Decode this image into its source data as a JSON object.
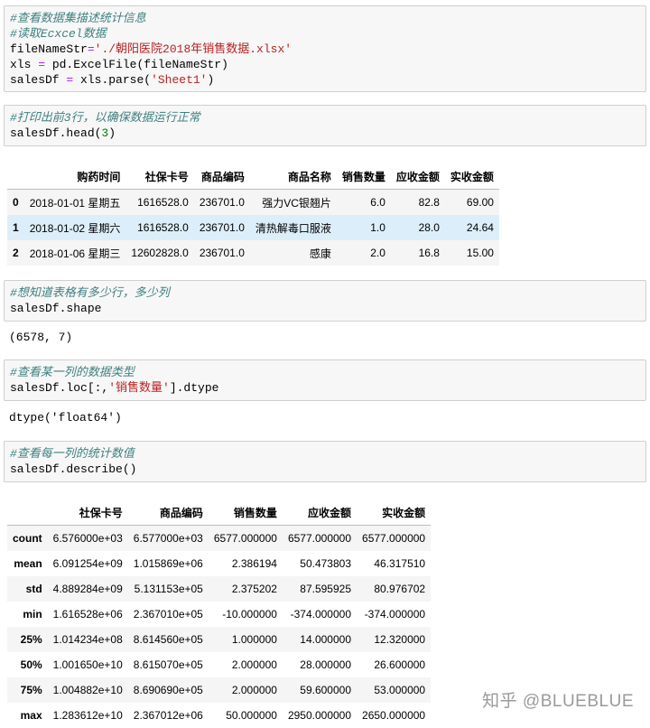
{
  "cells": [
    {
      "lines": [
        {
          "type": "comment",
          "text": "#查看数据集描述统计信息"
        },
        {
          "type": "comment",
          "text": "#读取Ecxcel数据"
        },
        {
          "type": "mixed",
          "parts": [
            {
              "c": "n",
              "t": "fileNameStr"
            },
            {
              "c": "op",
              "t": "="
            },
            {
              "c": "st",
              "t": "'./朝阳医院2018年销售数据.xlsx'"
            }
          ]
        },
        {
          "type": "mixed",
          "parts": [
            {
              "c": "n",
              "t": "xls "
            },
            {
              "c": "op",
              "t": "="
            },
            {
              "c": "n",
              "t": " pd.ExcelFile(fileNameStr)"
            }
          ]
        },
        {
          "type": "mixed",
          "parts": [
            {
              "c": "n",
              "t": "salesDf "
            },
            {
              "c": "op",
              "t": "="
            },
            {
              "c": "n",
              "t": " xls.parse("
            },
            {
              "c": "st",
              "t": "'Sheet1'"
            },
            {
              "c": "n",
              "t": ")"
            }
          ]
        }
      ]
    },
    {
      "lines": [
        {
          "type": "comment",
          "text": "#打印出前3行，以确保数据运行正常"
        },
        {
          "type": "mixed",
          "parts": [
            {
              "c": "n",
              "t": "salesDf.head("
            },
            {
              "c": "num",
              "t": "3"
            },
            {
              "c": "n",
              "t": ")"
            }
          ]
        }
      ]
    },
    {
      "lines": [
        {
          "type": "comment",
          "text": "#想知道表格有多少行，多少列"
        },
        {
          "type": "mixed",
          "parts": [
            {
              "c": "n",
              "t": "salesDf.shape"
            }
          ]
        }
      ]
    },
    {
      "lines": [
        {
          "type": "comment",
          "text": "#查看某一列的数据类型"
        },
        {
          "type": "mixed",
          "parts": [
            {
              "c": "n",
              "t": "salesDf.loc[:,"
            },
            {
              "c": "st",
              "t": "'销售数量'"
            },
            {
              "c": "n",
              "t": "].dtype"
            }
          ]
        }
      ]
    },
    {
      "lines": [
        {
          "type": "comment",
          "text": "#查看每一列的统计数值"
        },
        {
          "type": "mixed",
          "parts": [
            {
              "c": "n",
              "t": "salesDf.describe()"
            }
          ]
        }
      ]
    }
  ],
  "head_table": {
    "columns": [
      "",
      "购药时间",
      "社保卡号",
      "商品编码",
      "商品名称",
      "销售数量",
      "应收金额",
      "实收金额"
    ],
    "rows": [
      [
        "0",
        "2018-01-01 星期五",
        "1616528.0",
        "236701.0",
        "强力VC银翘片",
        "6.0",
        "82.8",
        "69.00"
      ],
      [
        "1",
        "2018-01-02 星期六",
        "1616528.0",
        "236701.0",
        "清热解毒口服液",
        "1.0",
        "28.0",
        "24.64"
      ],
      [
        "2",
        "2018-01-06 星期三",
        "12602828.0",
        "236701.0",
        "感康",
        "2.0",
        "16.8",
        "15.00"
      ]
    ]
  },
  "shape_output": "(6578, 7)",
  "dtype_output": "dtype('float64')",
  "describe_table": {
    "columns": [
      "",
      "社保卡号",
      "商品编码",
      "销售数量",
      "应收金额",
      "实收金额"
    ],
    "rows": [
      [
        "count",
        "6.576000e+03",
        "6.577000e+03",
        "6577.000000",
        "6577.000000",
        "6577.000000"
      ],
      [
        "mean",
        "6.091254e+09",
        "1.015869e+06",
        "2.386194",
        "50.473803",
        "46.317510"
      ],
      [
        "std",
        "4.889284e+09",
        "5.131153e+05",
        "2.375202",
        "87.595925",
        "80.976702"
      ],
      [
        "min",
        "1.616528e+06",
        "2.367010e+05",
        "-10.000000",
        "-374.000000",
        "-374.000000"
      ],
      [
        "25%",
        "1.014234e+08",
        "8.614560e+05",
        "1.000000",
        "14.000000",
        "12.320000"
      ],
      [
        "50%",
        "1.001650e+10",
        "8.615070e+05",
        "2.000000",
        "28.000000",
        "26.600000"
      ],
      [
        "75%",
        "1.004882e+10",
        "8.690690e+05",
        "2.000000",
        "59.600000",
        "53.000000"
      ],
      [
        "max",
        "1.283612e+10",
        "2.367012e+06",
        "50.000000",
        "2950.000000",
        "2650.000000"
      ]
    ]
  },
  "watermark": "知乎 @BLUEBLUE"
}
